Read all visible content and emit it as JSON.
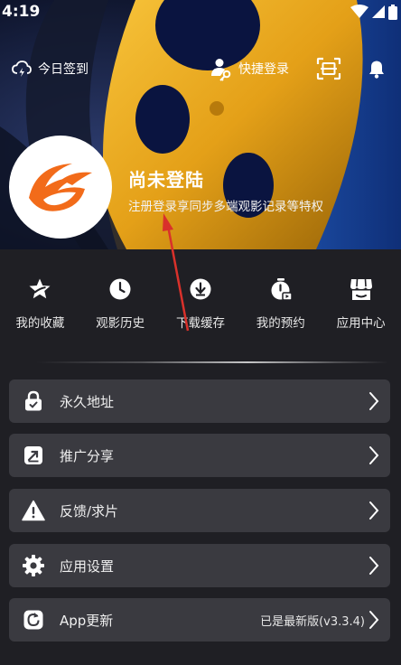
{
  "status_bar": {
    "time": "4:19"
  },
  "header": {
    "checkin_label": "今日签到",
    "quick_login_label": "快捷登录"
  },
  "profile": {
    "title": "尚未登陆",
    "subtitle": "注册登录享同步多端观影记录等特权"
  },
  "quick_actions": [
    {
      "label": "我的收藏",
      "icon": "star-icon"
    },
    {
      "label": "观影历史",
      "icon": "clock-icon"
    },
    {
      "label": "下载缓存",
      "icon": "download-icon"
    },
    {
      "label": "我的预约",
      "icon": "timer-icon"
    },
    {
      "label": "应用中心",
      "icon": "store-icon"
    }
  ],
  "menu": [
    {
      "label": "永久地址",
      "icon": "lock-icon"
    },
    {
      "label": "推广分享",
      "icon": "share-icon"
    },
    {
      "label": "反馈/求片",
      "icon": "warning-icon"
    },
    {
      "label": "应用设置",
      "icon": "gear-icon"
    },
    {
      "label": "App更新",
      "icon": "refresh-icon",
      "value": "已是最新版(v3.3.4)"
    }
  ],
  "colors": {
    "background": "#1f1f24",
    "row_background": "#3a3a40",
    "brand_orange": "#f26b1a",
    "annotation_red": "#d9312b"
  }
}
